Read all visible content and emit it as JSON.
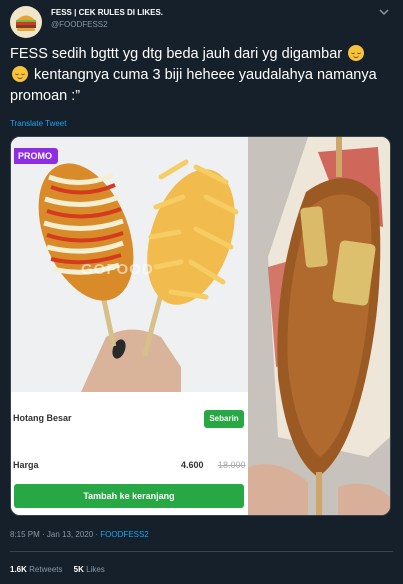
{
  "account": {
    "name": "FESS | CEK RULES DI LIKES.",
    "handle": "@FOODFESS2",
    "avatar_icon": "burger-icon"
  },
  "tweet": {
    "text_part1": "FESS sedih bgttt yg dtg beda jauh dari yg digambar",
    "text_part2": "kentangnya cuma 3 biji heheee yaudalahya namanya promoan :”",
    "emoji": "relieved-face-emoji",
    "translate_label": "Translate Tweet"
  },
  "media": {
    "left": {
      "badge": "PROMO",
      "watermark": "GOFOOD",
      "product_name": "Hotang Besar",
      "share_label": "Sebarin",
      "price_label": "Harga",
      "price_now": "4.600",
      "price_old": "18.000",
      "cart_button": "Tambah ke keranjang"
    }
  },
  "meta": {
    "time": "8:15 PM · Jan 13, 2020 · ",
    "source": "FOODFESS2",
    "retweets_count": "1.6K",
    "retweets_label": "Retweets",
    "likes_count": "5K",
    "likes_label": "Likes"
  },
  "colors": {
    "background": "#15202b",
    "accent": "#1da1f2",
    "muted": "#8899a6",
    "green_button": "#27a844",
    "promo_badge": "#8e2de2"
  }
}
